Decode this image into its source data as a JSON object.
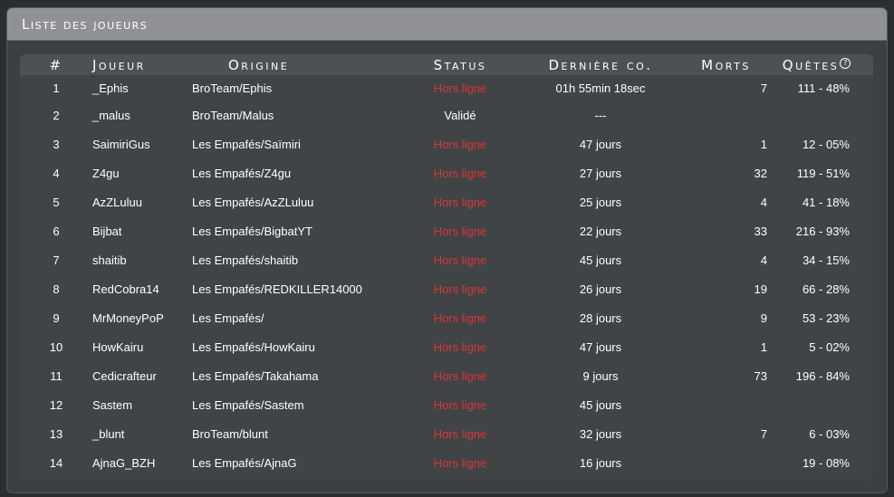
{
  "panel": {
    "title": "Liste des joueurs"
  },
  "columns": {
    "num": "#",
    "player": "Joueur",
    "origin": "Origine",
    "status": "Status",
    "last": "Dernière co.",
    "deaths": "Morts",
    "quests": "Quêtes"
  },
  "quests_help_icon": "question-circle-icon",
  "colors": {
    "offline": "#d93535",
    "panel_header": "#8f9194",
    "panel": "#3d4043"
  },
  "rows": [
    {
      "num": "1",
      "player": "_Ephis",
      "origin": "BroTeam/Ephis",
      "status": "Hors ligne",
      "offline": true,
      "last": "01h 55min 18sec",
      "deaths": "7",
      "quests": "111 - 48%"
    },
    {
      "num": "2",
      "player": "_malus",
      "origin": "BroTeam/Malus",
      "status": "Validé",
      "offline": false,
      "last": "---",
      "deaths": "",
      "quests": ""
    },
    {
      "num": "3",
      "player": "SaimiriGus",
      "origin": "Les Empafés/Saïmiri",
      "status": "Hors ligne",
      "offline": true,
      "last": "47 jours",
      "deaths": "1",
      "quests": "12 - 05%"
    },
    {
      "num": "4",
      "player": "Z4gu",
      "origin": "Les Empafés/Z4gu",
      "status": "Hors ligne",
      "offline": true,
      "last": "27 jours",
      "deaths": "32",
      "quests": "119 - 51%"
    },
    {
      "num": "5",
      "player": "AzZLuluu",
      "origin": "Les Empafés/AzZLuluu",
      "status": "Hors ligne",
      "offline": true,
      "last": "25 jours",
      "deaths": "4",
      "quests": "41 - 18%"
    },
    {
      "num": "6",
      "player": "Bijbat",
      "origin": "Les Empafés/BigbatYT",
      "status": "Hors ligne",
      "offline": true,
      "last": "22 jours",
      "deaths": "33",
      "quests": "216 - 93%"
    },
    {
      "num": "7",
      "player": "shaitib",
      "origin": "Les Empafés/shaitib",
      "status": "Hors ligne",
      "offline": true,
      "last": "45 jours",
      "deaths": "4",
      "quests": "34 - 15%"
    },
    {
      "num": "8",
      "player": "RedCobra14",
      "origin": "Les Empafés/REDKILLER14000",
      "status": "Hors ligne",
      "offline": true,
      "last": "26 jours",
      "deaths": "19",
      "quests": "66 - 28%"
    },
    {
      "num": "9",
      "player": "MrMoneyPoP",
      "origin": "Les Empafés/",
      "status": "Hors ligne",
      "offline": true,
      "last": "28 jours",
      "deaths": "9",
      "quests": "53 - 23%"
    },
    {
      "num": "10",
      "player": "HowKairu",
      "origin": "Les Empafés/HowKairu",
      "status": "Hors ligne",
      "offline": true,
      "last": "47 jours",
      "deaths": "1",
      "quests": "5 - 02%"
    },
    {
      "num": "11",
      "player": "Cedicrafteur",
      "origin": "Les Empafés/Takahama",
      "status": "Hors ligne",
      "offline": true,
      "last": "9 jours",
      "deaths": "73",
      "quests": "196 - 84%"
    },
    {
      "num": "12",
      "player": "Sastem",
      "origin": "Les Empafés/Sastem",
      "status": "Hors ligne",
      "offline": true,
      "last": "45 jours",
      "deaths": "",
      "quests": ""
    },
    {
      "num": "13",
      "player": "_blunt",
      "origin": "BroTeam/blunt",
      "status": "Hors ligne",
      "offline": true,
      "last": "32 jours",
      "deaths": "7",
      "quests": "6 - 03%"
    },
    {
      "num": "14",
      "player": "AjnaG_BZH",
      "origin": "Les Empafés/AjnaG",
      "status": "Hors ligne",
      "offline": true,
      "last": "16 jours",
      "deaths": "",
      "quests": "19 - 08%"
    }
  ]
}
